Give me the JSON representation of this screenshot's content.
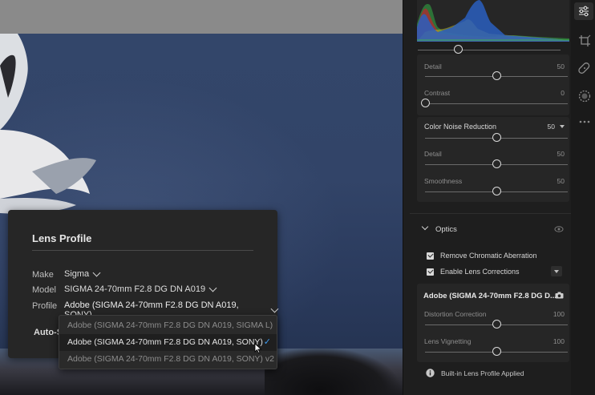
{
  "lens_profile": {
    "title": "Lens Profile",
    "make_label": "Make",
    "make_value": "Sigma",
    "model_label": "Model",
    "model_value": "SIGMA 24-70mm F2.8 DG DN A019",
    "profile_label": "Profile",
    "profile_value": "Adobe (SIGMA 24-70mm F2.8 DG DN A019, SONY)",
    "auto_button": "Auto-S",
    "profile_options": [
      "Adobe (SIGMA 24-70mm F2.8 DG DN A019, SIGMA L)",
      "Adobe (SIGMA 24-70mm F2.8 DG DN A019, SONY)",
      "Adobe (SIGMA 24-70mm F2.8 DG DN A019, SONY) v2"
    ],
    "selected_option": 1
  },
  "detail": {
    "top_slider_value": 0.28,
    "detail": {
      "label": "Detail",
      "value": "50",
      "fraction": 0.5
    },
    "contrast": {
      "label": "Contrast",
      "value": "0",
      "fraction": 0.0
    }
  },
  "color_noise": {
    "title": "Color Noise Reduction",
    "value": "50",
    "fraction": 0.5,
    "detail": {
      "label": "Detail",
      "value": "50",
      "fraction": 0.5
    },
    "smoothness": {
      "label": "Smoothness",
      "value": "50",
      "fraction": 0.5
    }
  },
  "optics": {
    "title": "Optics",
    "remove_ca": "Remove Chromatic Aberration",
    "enable_lens": "Enable Lens Corrections",
    "profile_header": "Adobe (SIGMA 24-70mm F2.8 DG D...",
    "distortion": {
      "label": "Distortion Correction",
      "value": "100",
      "fraction": 0.5
    },
    "vignetting": {
      "label": "Lens Vignetting",
      "value": "100",
      "fraction": 0.5
    },
    "info": "Built-in Lens Profile Applied"
  },
  "colors": {
    "accent": "#3e9cf0",
    "panel": "#262626",
    "background": "#1e1e1e"
  },
  "tools": [
    "edit-sliders-icon",
    "crop-icon",
    "heal-icon",
    "mask-icon",
    "more-icon"
  ]
}
